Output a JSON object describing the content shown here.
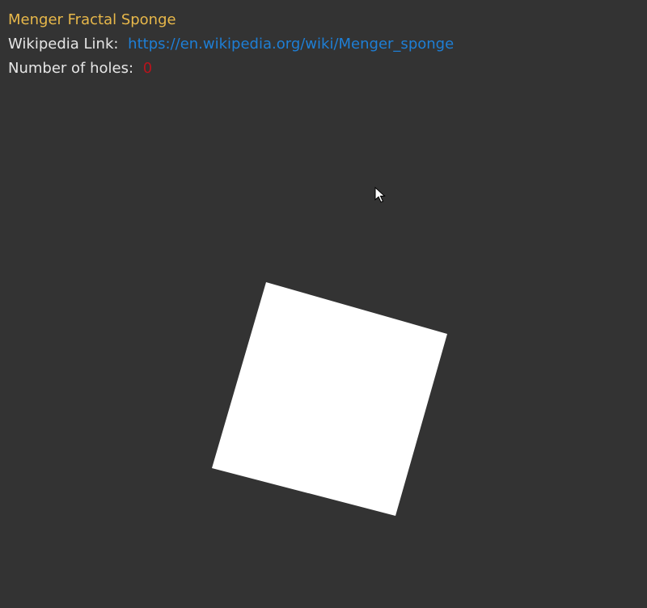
{
  "header": {
    "title": "Menger Fractal Sponge",
    "wiki_label": "Wikipedia Link:",
    "wiki_url": "https://en.wikipedia.org/wiki/Menger_sponge",
    "holes_label": "Number of holes:",
    "holes_count": "0"
  },
  "colors": {
    "background": "#333333",
    "title": "#e8b84a",
    "label": "#e6e6e6",
    "link": "#1e7fd6",
    "holes": "#b8141c",
    "cube": "#ffffff"
  },
  "scene": {
    "object": "cube",
    "cursor_icon": "arrow-cursor-icon"
  }
}
